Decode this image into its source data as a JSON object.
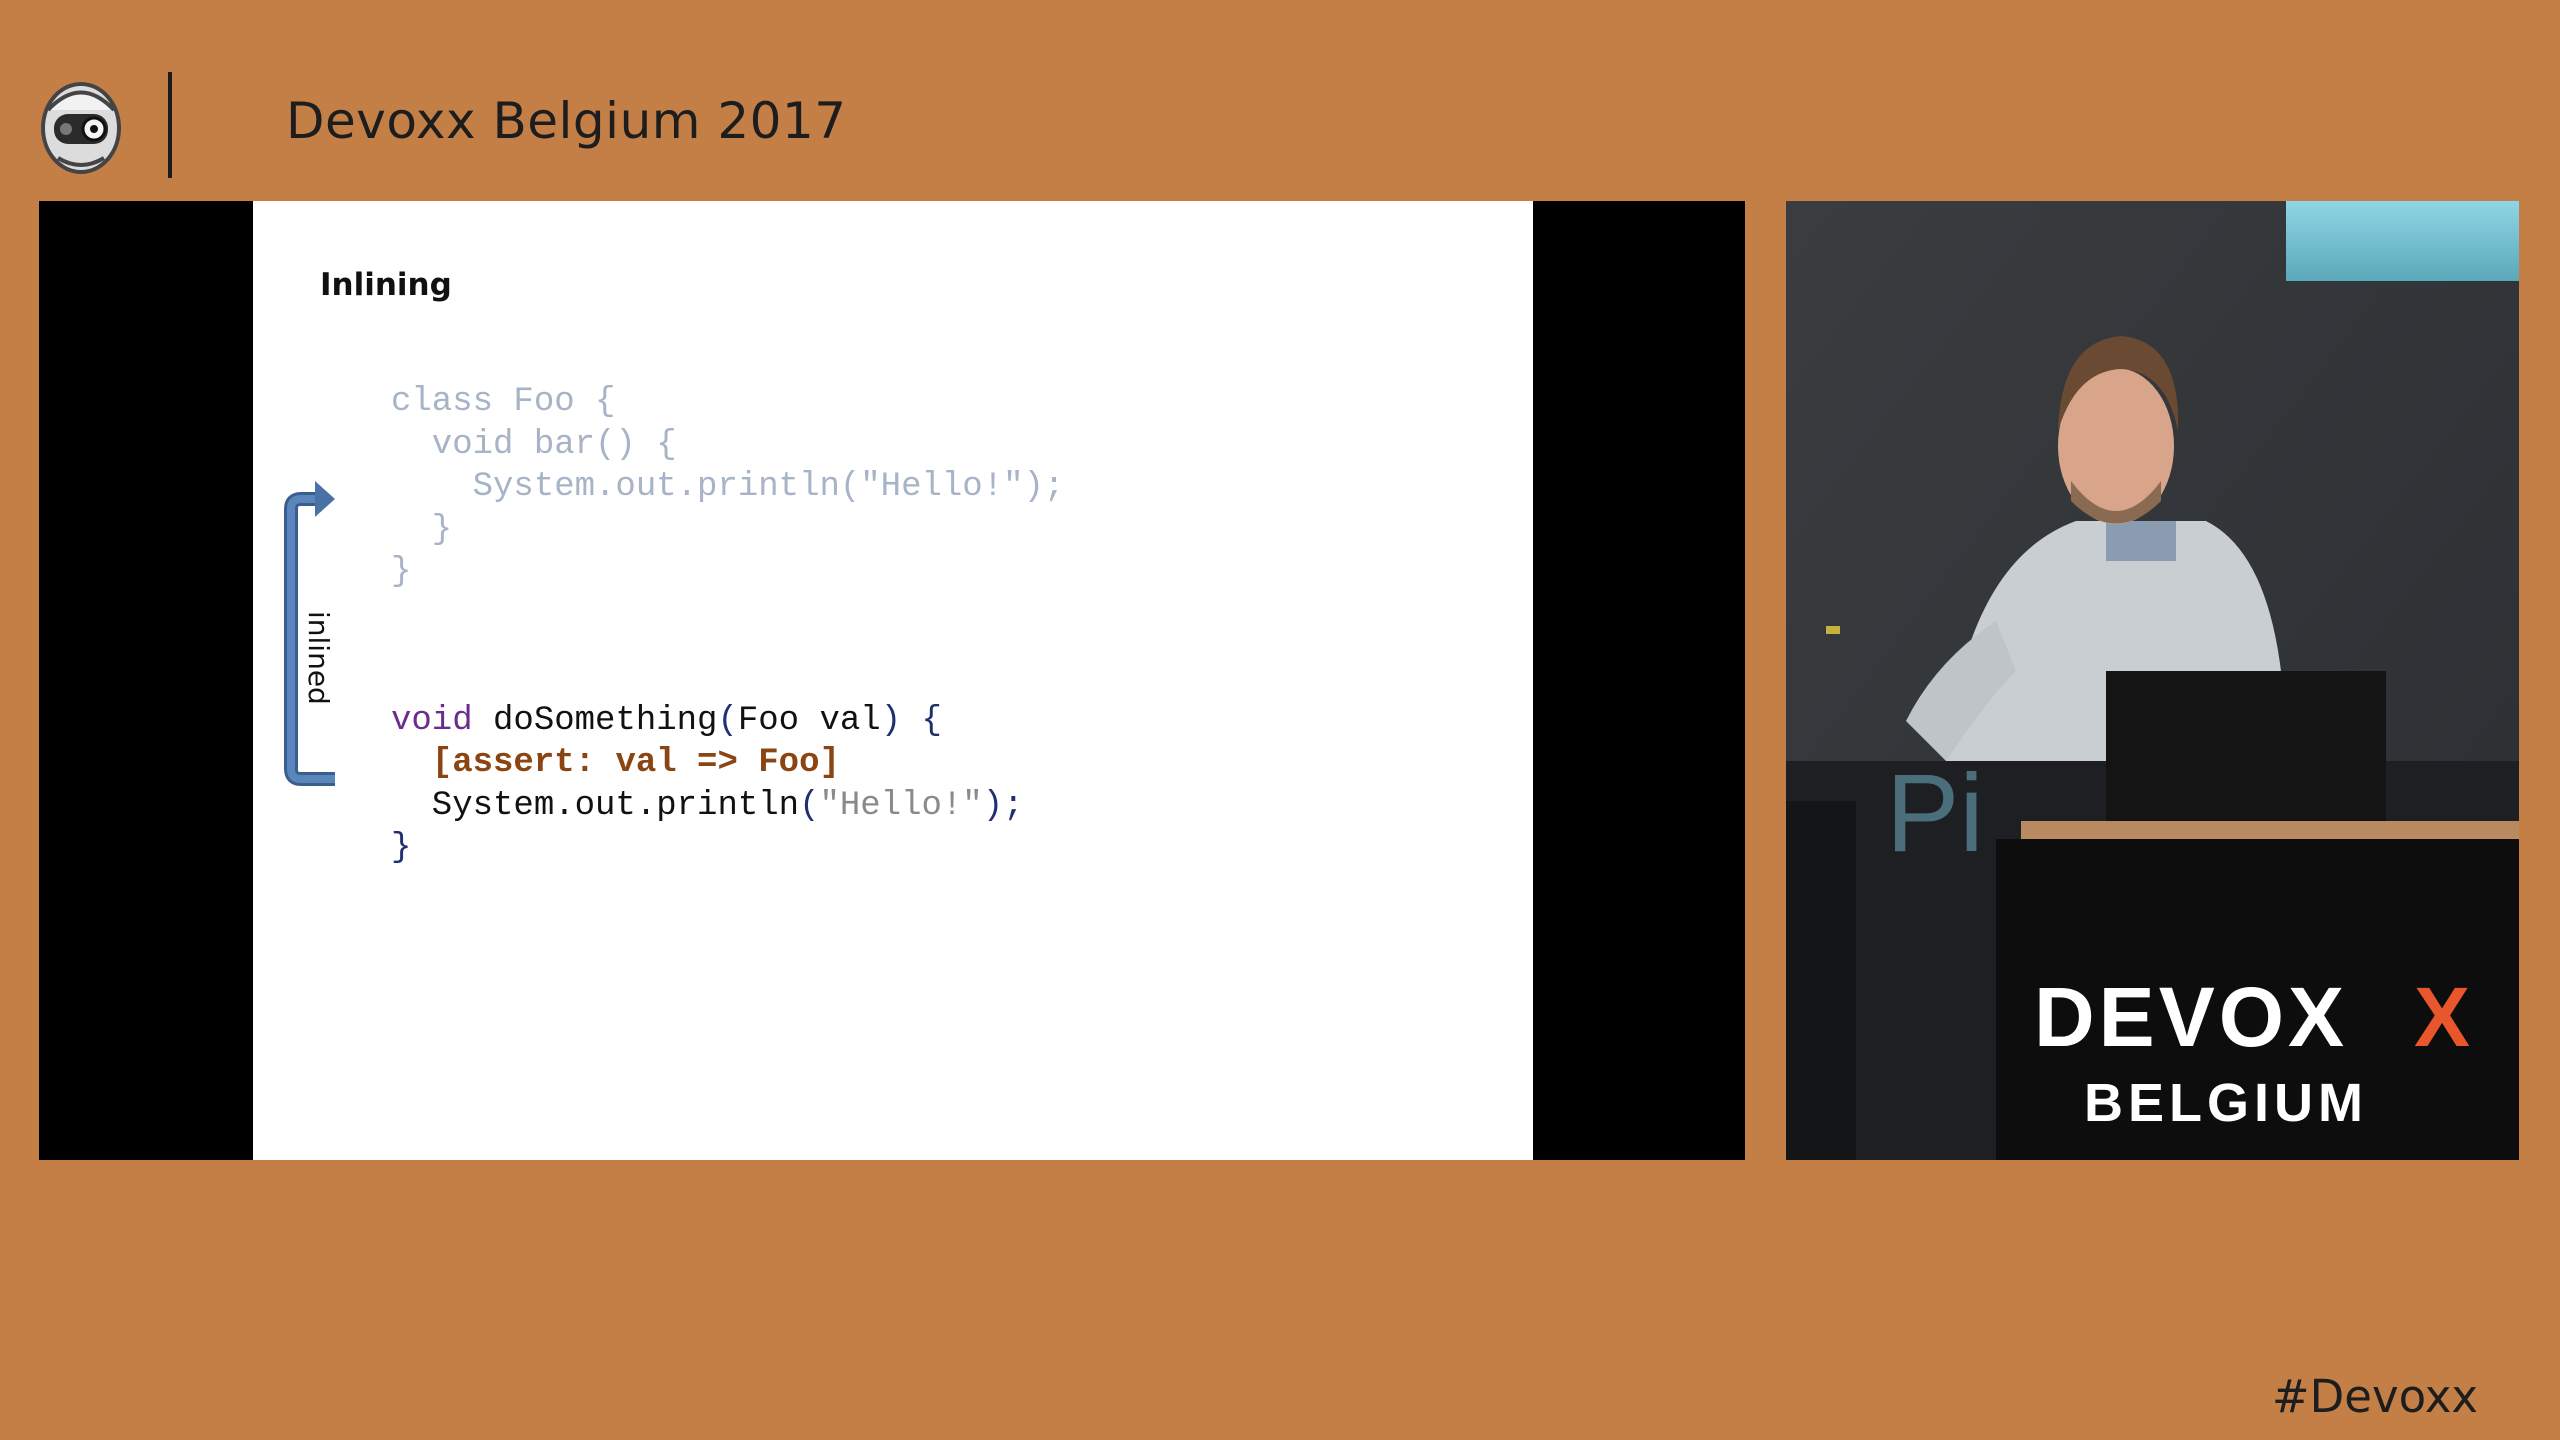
{
  "header": {
    "conference_title": "Devoxx Belgium 2017",
    "logo_icon": "devoxx-robot-icon"
  },
  "slide": {
    "title": "Inlining",
    "side_label": "inlined",
    "code": {
      "class_foo": [
        [
          {
            "t": "class Foo {",
            "c": "faded"
          }
        ],
        [
          {
            "t": "  void bar() {",
            "c": "faded"
          }
        ],
        [
          {
            "t": "    System.out.println(\"Hello!\");",
            "c": "faded"
          }
        ],
        [
          {
            "t": "  }",
            "c": "faded"
          }
        ],
        [
          {
            "t": "}",
            "c": "faded"
          }
        ]
      ],
      "do_something": [
        [
          {
            "t": "void",
            "c": "t-kw"
          },
          {
            "t": " doSomething",
            "c": "t-plain"
          },
          {
            "t": "(",
            "c": "t-punct"
          },
          {
            "t": "Foo val",
            "c": "t-plain"
          },
          {
            "t": ") {",
            "c": "t-punct"
          }
        ],
        [
          {
            "t": "  ",
            "c": "t-plain"
          },
          {
            "t": "[assert: val => Foo]",
            "c": "t-assert"
          }
        ],
        [
          {
            "t": "  System.out.println",
            "c": "t-plain"
          },
          {
            "t": "(",
            "c": "t-punct"
          },
          {
            "t": "\"Hello!\"",
            "c": "t-str"
          },
          {
            "t": ");",
            "c": "t-punct"
          }
        ],
        [
          {
            "t": "}",
            "c": "t-punct"
          }
        ]
      ]
    }
  },
  "camera": {
    "banner_top": "DEVOX",
    "banner_x": "X",
    "banner_bottom": "BELGIUM",
    "screen_fragment": "Pi"
  },
  "footer": {
    "hashtag": "#Devoxx"
  },
  "colors": {
    "background": "#c47f47",
    "accent_arrow": "#4a72a6",
    "brand_x": "#e8572b"
  }
}
